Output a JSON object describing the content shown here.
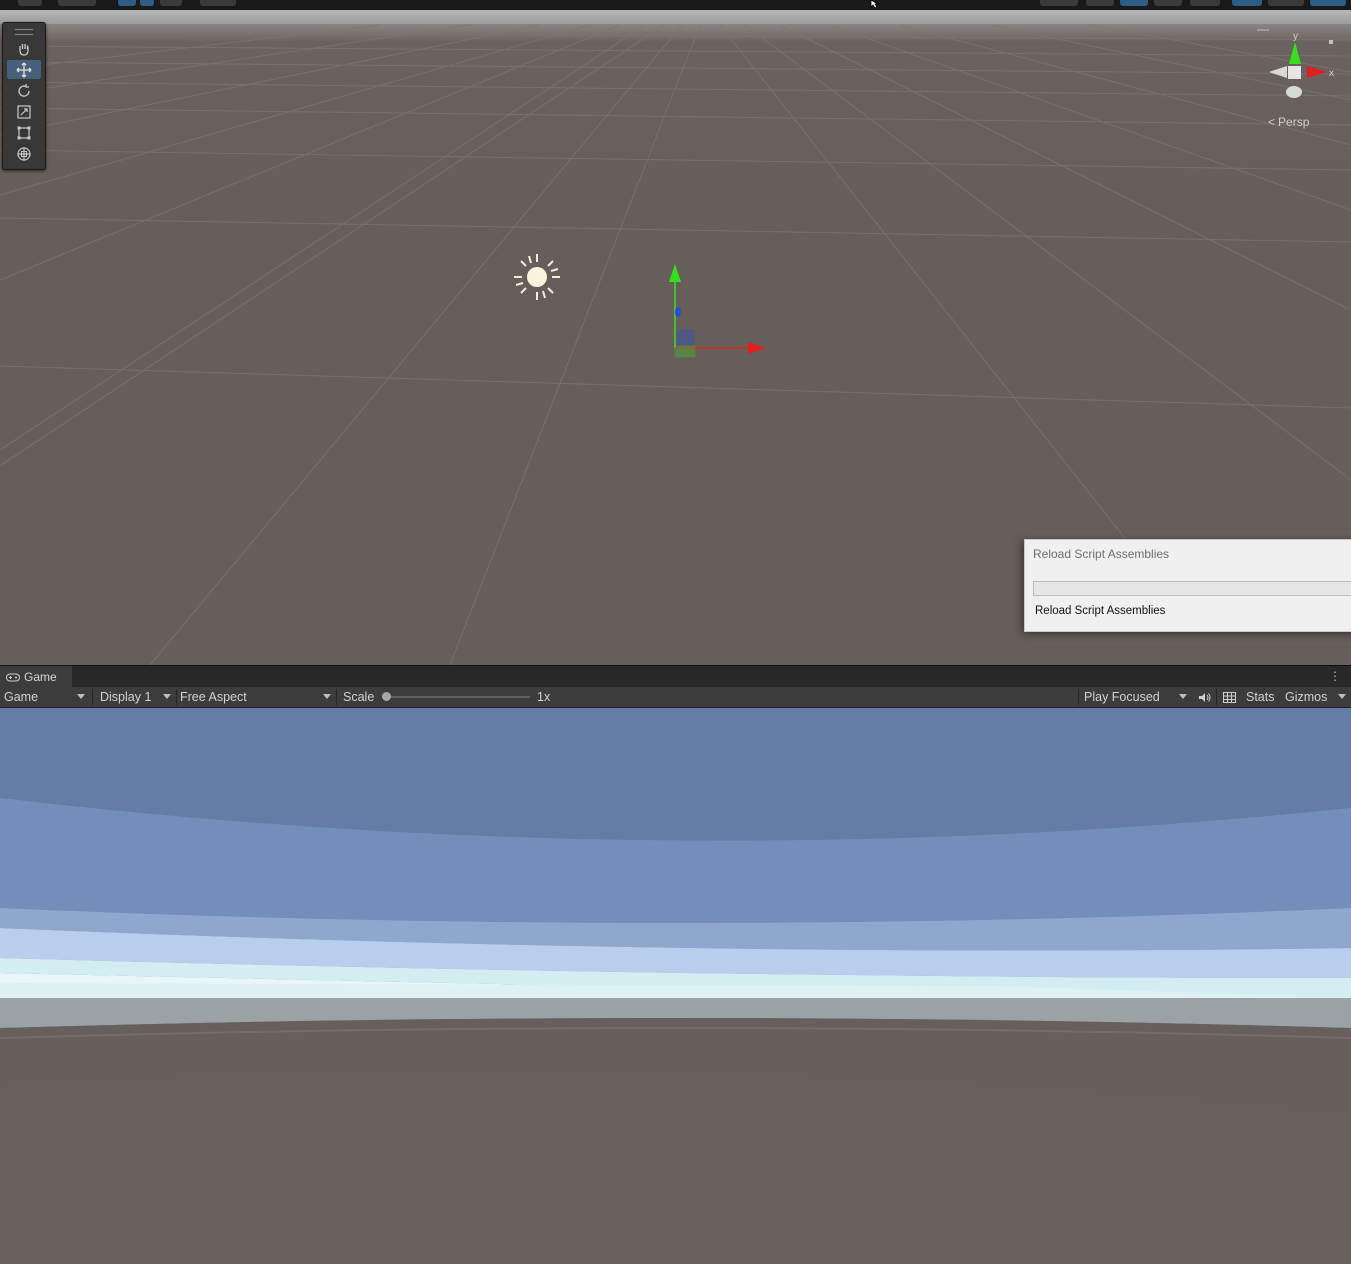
{
  "scene_view": {
    "camera_label": "Persp",
    "axis_labels": {
      "y": "y",
      "x": "x"
    },
    "tools": [
      {
        "name": "hand-tool",
        "active": false
      },
      {
        "name": "move-tool",
        "active": true
      },
      {
        "name": "rotate-tool",
        "active": false
      },
      {
        "name": "scale-tool",
        "active": false
      },
      {
        "name": "rect-tool",
        "active": false
      },
      {
        "name": "transform-tool",
        "active": false
      }
    ]
  },
  "reload_dialog": {
    "title": "Reload Script Assemblies",
    "message": "Reload Script Assemblies",
    "progress": 0
  },
  "game_panel": {
    "tab_label": "Game",
    "toolbar": {
      "view_mode": "Game",
      "display": "Display 1",
      "aspect": "Free Aspect",
      "scale_label": "Scale",
      "scale_value": "1x",
      "play_mode": "Play Focused",
      "stats_label": "Stats",
      "gizmos_label": "Gizmos"
    }
  },
  "colors": {
    "scene_ground": "#665e5a",
    "sky_top": "#627aa2",
    "horizon": "#d3eef3",
    "axis_x": "#e0201c",
    "axis_y": "#36e01c",
    "axis_z": "#2a4bd7",
    "active_tool": "#46607c",
    "progress_fill": "#06b025"
  }
}
